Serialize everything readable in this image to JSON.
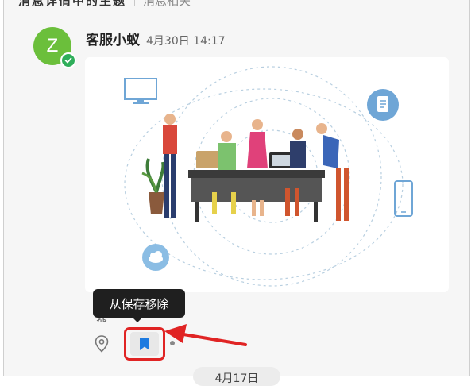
{
  "header": {
    "title": "消息详情中的主题",
    "subtitle": "消息相关"
  },
  "message": {
    "avatar_letter": "Z",
    "sender_name": "客服小蚁",
    "timestamp": "4月30日 14:17",
    "text_partial": "其他"
  },
  "tooltip": {
    "label": "从保存移除"
  },
  "actions": {
    "pin_icon": "location-pin-icon",
    "bookmark_icon": "bookmark-icon",
    "more_icon": "more-dots-icon"
  },
  "date_divider": "4月17日",
  "colors": {
    "avatar": "#6bbf3b",
    "verified": "#2fae5a",
    "highlight": "#e02424",
    "bookmark": "#1e7be0",
    "tooltip_bg": "#1f1f1f"
  }
}
